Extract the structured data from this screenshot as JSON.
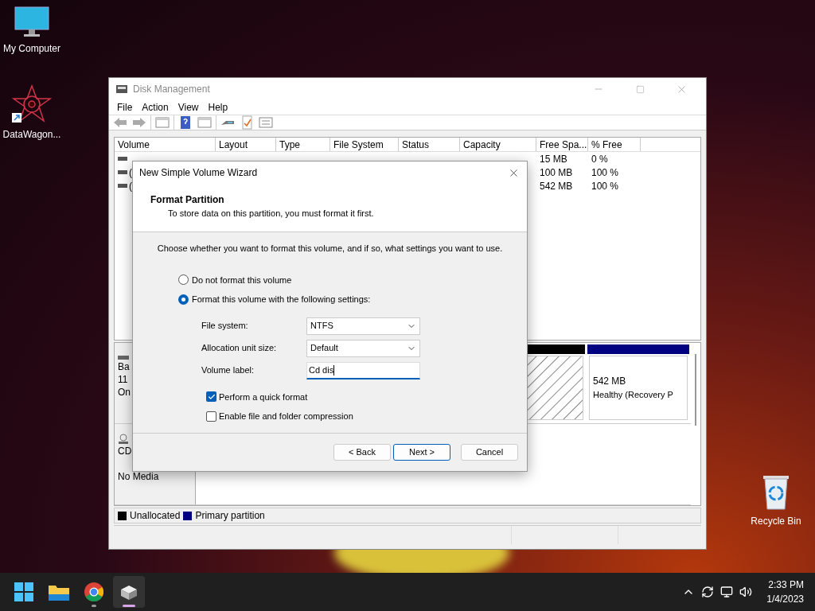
{
  "desktop_icons": [
    {
      "label": "My Computer",
      "kind": "computer"
    },
    {
      "label": "DataWagon...",
      "kind": "shortcut"
    },
    {
      "label": "Recycle Bin",
      "kind": "recycle"
    }
  ],
  "window": {
    "title": "Disk Management",
    "menu": [
      "File",
      "Action",
      "View",
      "Help"
    ],
    "volume_table": {
      "columns": [
        "Volume",
        "Layout",
        "Type",
        "File System",
        "Status",
        "Capacity",
        "Free Spa...",
        "% Free"
      ],
      "rows": [
        {
          "free_space": "15 MB",
          "percent_free": "0 %"
        },
        {
          "volume": "(",
          "free_space": "100 MB",
          "percent_free": "100 %"
        },
        {
          "volume": "(",
          "free_space": "542 MB",
          "percent_free": "100 %"
        }
      ]
    },
    "disks": [
      {
        "kind": "basic",
        "label_lines": [
          "Ba",
          "11",
          "On"
        ],
        "partitions": [
          {
            "kind": "unallocated"
          },
          {
            "kind": "primary",
            "size": "542 MB",
            "status": "Healthy (Recovery P"
          }
        ]
      },
      {
        "kind": "cdrom",
        "label_lines": [
          "CD",
          "No Media"
        ]
      }
    ],
    "legend": [
      {
        "label": "Unallocated",
        "color": "#000000"
      },
      {
        "label": "Primary partition",
        "color": "#000080"
      }
    ]
  },
  "wizard": {
    "title": "New Simple Volume Wizard",
    "heading": "Format Partition",
    "subheading": "To store data on this partition, you must format it first.",
    "instruction": "Choose whether you want to format this volume, and if so, what settings you want to use.",
    "options": [
      {
        "label": "Do not format this volume",
        "selected": false
      },
      {
        "label": "Format this volume with the following settings:",
        "selected": true
      }
    ],
    "settings": [
      {
        "kind": "dropdown",
        "label": "File system:",
        "value": "NTFS"
      },
      {
        "kind": "dropdown",
        "label": "Allocation unit size:",
        "value": "Default"
      },
      {
        "kind": "text",
        "label": "Volume label:",
        "value": "Cd dis",
        "focused": true
      }
    ],
    "checkboxes": [
      {
        "label": "Perform a quick format",
        "checked": true
      },
      {
        "label": "Enable file and folder compression",
        "checked": false
      }
    ],
    "buttons": [
      {
        "label": "< Back",
        "default": false
      },
      {
        "label": "Next >",
        "default": true
      },
      {
        "label": "Cancel",
        "default": false
      }
    ]
  },
  "taskbar": {
    "apps": [
      {
        "kind": "start",
        "running": false,
        "active": false
      },
      {
        "kind": "explorer",
        "running": false,
        "active": false
      },
      {
        "kind": "browser",
        "running": true,
        "active": false
      },
      {
        "kind": "disk",
        "running": true,
        "active": true
      }
    ],
    "time": "2:33 PM",
    "date": "1/4/2023"
  }
}
